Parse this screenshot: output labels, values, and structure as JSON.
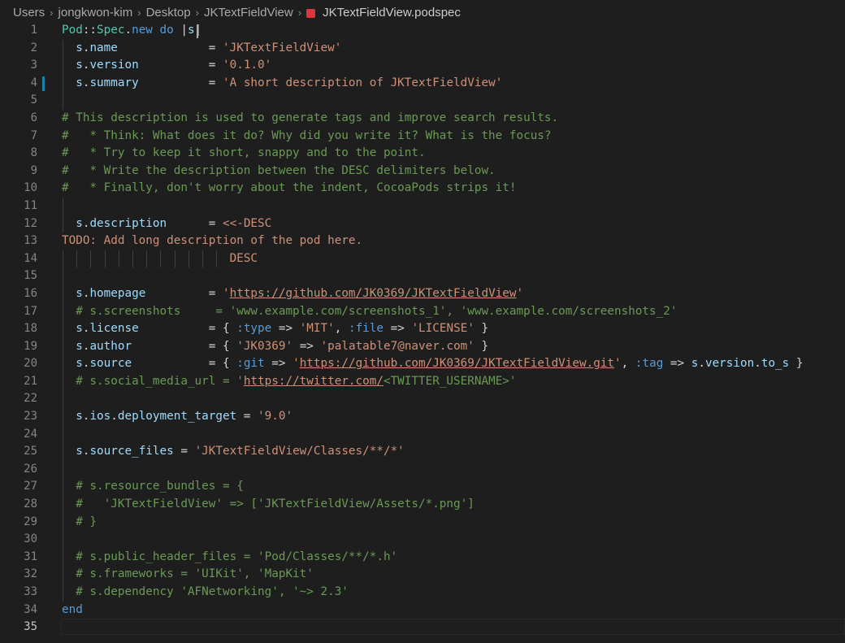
{
  "breadcrumb": {
    "items": [
      "Users",
      "jongkwon-kim",
      "Desktop",
      "JKTextFieldView"
    ],
    "file": "JKTextFieldView.podspec"
  },
  "editor": {
    "active_line": 35,
    "modified_line": 4,
    "lines": [
      {
        "n": "1",
        "indent": 0,
        "tokens": [
          [
            "k-const",
            "Pod"
          ],
          [
            "k-op",
            "::"
          ],
          [
            "k-const",
            "Spec"
          ],
          [
            "k-op",
            "."
          ],
          [
            "k-kw",
            "new"
          ],
          [
            "k-op",
            " "
          ],
          [
            "k-kw",
            "do"
          ],
          [
            "k-op",
            " |"
          ],
          [
            "k-var",
            "s"
          ],
          [
            "k-op",
            "|"
          ]
        ]
      },
      {
        "n": "2",
        "indent": 1,
        "tokens": [
          [
            "k-var",
            "s"
          ],
          [
            "k-op",
            "."
          ],
          [
            "k-var",
            "name"
          ],
          [
            "k-op",
            "             = "
          ],
          [
            "k-str",
            "'JKTextFieldView'"
          ]
        ]
      },
      {
        "n": "3",
        "indent": 1,
        "tokens": [
          [
            "k-var",
            "s"
          ],
          [
            "k-op",
            "."
          ],
          [
            "k-var",
            "version"
          ],
          [
            "k-op",
            "          = "
          ],
          [
            "k-str",
            "'0.1.0'"
          ]
        ]
      },
      {
        "n": "4",
        "indent": 1,
        "tokens": [
          [
            "k-var",
            "s"
          ],
          [
            "k-op",
            "."
          ],
          [
            "k-var",
            "summary"
          ],
          [
            "k-op",
            "          = "
          ],
          [
            "k-str",
            "'A short description of JKTextFieldView'"
          ]
        ]
      },
      {
        "n": "5",
        "indent": 1,
        "tokens": []
      },
      {
        "n": "6",
        "indent": 0,
        "tokens": [
          [
            "k-com",
            "# This description is used to generate tags and improve search results."
          ]
        ]
      },
      {
        "n": "7",
        "indent": 0,
        "tokens": [
          [
            "k-com",
            "#   * Think: What does it do? Why did you write it? What is the focus?"
          ]
        ]
      },
      {
        "n": "8",
        "indent": 0,
        "tokens": [
          [
            "k-com",
            "#   * Try to keep it short, snappy and to the point."
          ]
        ]
      },
      {
        "n": "9",
        "indent": 0,
        "tokens": [
          [
            "k-com",
            "#   * Write the description between the DESC delimiters below."
          ]
        ]
      },
      {
        "n": "10",
        "indent": 0,
        "tokens": [
          [
            "k-com",
            "#   * Finally, don't worry about the indent, CocoaPods strips it!"
          ]
        ]
      },
      {
        "n": "11",
        "indent": 1,
        "tokens": []
      },
      {
        "n": "12",
        "indent": 1,
        "tokens": [
          [
            "k-var",
            "s"
          ],
          [
            "k-op",
            "."
          ],
          [
            "k-var",
            "description"
          ],
          [
            "k-op",
            "      = "
          ],
          [
            "k-str",
            "<<-DESC"
          ]
        ]
      },
      {
        "n": "13",
        "indent": 0,
        "tokens": [
          [
            "k-str",
            "TODO: Add long description of the pod here."
          ]
        ]
      },
      {
        "n": "14",
        "indent": 12,
        "tokens": [
          [
            "k-str",
            "                        DESC"
          ]
        ]
      },
      {
        "n": "15",
        "indent": 1,
        "tokens": []
      },
      {
        "n": "16",
        "indent": 1,
        "tokens": [
          [
            "k-var",
            "s"
          ],
          [
            "k-op",
            "."
          ],
          [
            "k-var",
            "homepage"
          ],
          [
            "k-op",
            "         = "
          ],
          [
            "k-str",
            "'"
          ],
          [
            "k-url",
            "https://github.com/JK0369/JKTextFieldView"
          ],
          [
            "k-str",
            "'"
          ]
        ]
      },
      {
        "n": "17",
        "indent": 1,
        "tokens": [
          [
            "k-com",
            "# s.screenshots     = 'www.example.com/screenshots_1', 'www.example.com/screenshots_2'"
          ]
        ]
      },
      {
        "n": "18",
        "indent": 1,
        "tokens": [
          [
            "k-var",
            "s"
          ],
          [
            "k-op",
            "."
          ],
          [
            "k-var",
            "license"
          ],
          [
            "k-op",
            "          = { "
          ],
          [
            "k-sym",
            ":type"
          ],
          [
            "k-op",
            " => "
          ],
          [
            "k-str",
            "'MIT'"
          ],
          [
            "k-op",
            ", "
          ],
          [
            "k-sym",
            ":file"
          ],
          [
            "k-op",
            " => "
          ],
          [
            "k-str",
            "'LICENSE'"
          ],
          [
            "k-op",
            " }"
          ]
        ]
      },
      {
        "n": "19",
        "indent": 1,
        "tokens": [
          [
            "k-var",
            "s"
          ],
          [
            "k-op",
            "."
          ],
          [
            "k-var",
            "author"
          ],
          [
            "k-op",
            "           = { "
          ],
          [
            "k-str",
            "'JK0369'"
          ],
          [
            "k-op",
            " => "
          ],
          [
            "k-str",
            "'palatable7@naver.com'"
          ],
          [
            "k-op",
            " }"
          ]
        ]
      },
      {
        "n": "20",
        "indent": 1,
        "tokens": [
          [
            "k-var",
            "s"
          ],
          [
            "k-op",
            "."
          ],
          [
            "k-var",
            "source"
          ],
          [
            "k-op",
            "           = { "
          ],
          [
            "k-sym",
            ":git"
          ],
          [
            "k-op",
            " => "
          ],
          [
            "k-str",
            "'"
          ],
          [
            "k-url",
            "https://github.com/JK0369/JKTextFieldView.git"
          ],
          [
            "k-str",
            "'"
          ],
          [
            "k-op",
            ", "
          ],
          [
            "k-sym",
            ":tag"
          ],
          [
            "k-op",
            " => "
          ],
          [
            "k-var",
            "s"
          ],
          [
            "k-op",
            "."
          ],
          [
            "k-var",
            "version"
          ],
          [
            "k-op",
            "."
          ],
          [
            "k-var",
            "to_s"
          ],
          [
            "k-op",
            " }"
          ]
        ]
      },
      {
        "n": "21",
        "indent": 1,
        "tokens": [
          [
            "k-com",
            "# s.social_media_url = '"
          ],
          [
            "k-url",
            "https://twitter.com/"
          ],
          [
            "k-com",
            "<TWITTER_USERNAME>'"
          ]
        ]
      },
      {
        "n": "22",
        "indent": 1,
        "tokens": []
      },
      {
        "n": "23",
        "indent": 1,
        "tokens": [
          [
            "k-var",
            "s"
          ],
          [
            "k-op",
            "."
          ],
          [
            "k-var",
            "ios"
          ],
          [
            "k-op",
            "."
          ],
          [
            "k-var",
            "deployment_target"
          ],
          [
            "k-op",
            " = "
          ],
          [
            "k-str",
            "'9.0'"
          ]
        ]
      },
      {
        "n": "24",
        "indent": 1,
        "tokens": []
      },
      {
        "n": "25",
        "indent": 1,
        "tokens": [
          [
            "k-var",
            "s"
          ],
          [
            "k-op",
            "."
          ],
          [
            "k-var",
            "source_files"
          ],
          [
            "k-op",
            " = "
          ],
          [
            "k-str",
            "'JKTextFieldView/Classes/**/*'"
          ]
        ]
      },
      {
        "n": "26",
        "indent": 1,
        "tokens": []
      },
      {
        "n": "27",
        "indent": 1,
        "tokens": [
          [
            "k-com",
            "# s.resource_bundles = {"
          ]
        ]
      },
      {
        "n": "28",
        "indent": 1,
        "tokens": [
          [
            "k-com",
            "#   'JKTextFieldView' => ['JKTextFieldView/Assets/*.png']"
          ]
        ]
      },
      {
        "n": "29",
        "indent": 1,
        "tokens": [
          [
            "k-com",
            "# }"
          ]
        ]
      },
      {
        "n": "30",
        "indent": 1,
        "tokens": []
      },
      {
        "n": "31",
        "indent": 1,
        "tokens": [
          [
            "k-com",
            "# s.public_header_files = 'Pod/Classes/**/*.h'"
          ]
        ]
      },
      {
        "n": "32",
        "indent": 1,
        "tokens": [
          [
            "k-com",
            "# s.frameworks = 'UIKit', 'MapKit'"
          ]
        ]
      },
      {
        "n": "33",
        "indent": 1,
        "tokens": [
          [
            "k-com",
            "# s.dependency 'AFNetworking', '~> 2.3'"
          ]
        ]
      },
      {
        "n": "34",
        "indent": 0,
        "tokens": [
          [
            "k-kw",
            "end"
          ]
        ]
      },
      {
        "n": "35",
        "indent": 0,
        "tokens": []
      }
    ]
  }
}
